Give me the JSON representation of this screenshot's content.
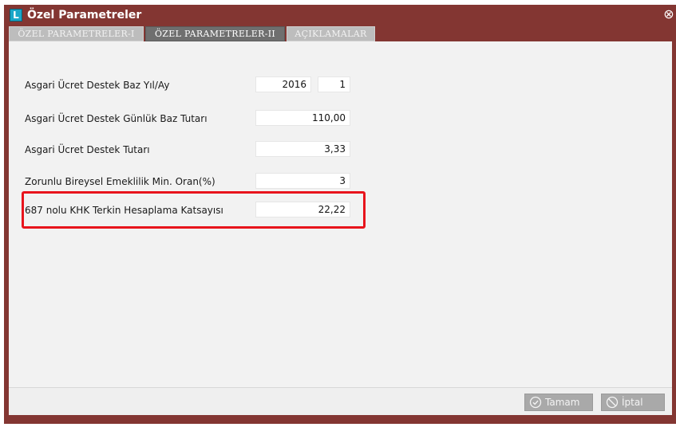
{
  "window": {
    "title": "Özel Parametreler",
    "app_icon_letter": "L",
    "close_glyph": "⊗"
  },
  "tabs": [
    {
      "label": "ÖZEL PARAMETRELER-I",
      "active": false
    },
    {
      "label": "ÖZEL PARAMETRELER-II",
      "active": true
    },
    {
      "label": "AÇIKLAMALAR",
      "active": false
    }
  ],
  "form": {
    "base_year_month": {
      "label": "Asgari Ücret Destek Baz Yıl/Ay",
      "year": "2016",
      "month": "1"
    },
    "daily_base_amount": {
      "label": "Asgari Ücret Destek Günlük Baz Tutarı",
      "value": "110,00"
    },
    "support_amount": {
      "label": "Asgari Ücret Destek Tutarı",
      "value": "3,33"
    },
    "pension_min_rate": {
      "label": "Zorunlu Bireysel Emeklilik Min. Oran(%)",
      "value": "3"
    },
    "khk_coefficient": {
      "label": "687 nolu KHK Terkin Hesaplama Katsayısı",
      "value": "22,22"
    }
  },
  "footer": {
    "ok_label": "Tamam",
    "cancel_label": "İptal"
  },
  "colors": {
    "titlebar": "#833632",
    "highlight": "#e8141c"
  }
}
